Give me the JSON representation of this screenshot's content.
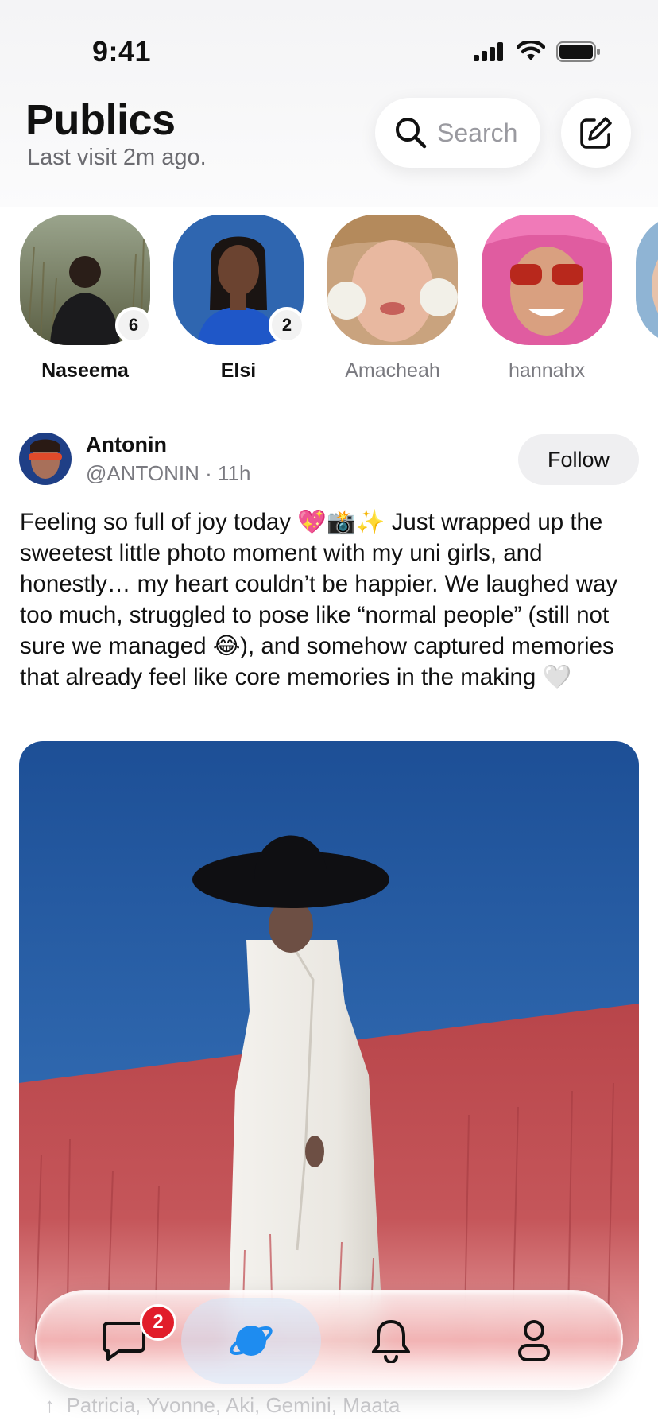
{
  "status_bar": {
    "time": "9:41"
  },
  "header": {
    "title": "Publics",
    "subtitle": "Last visit 2m ago.",
    "search_placeholder": "Search"
  },
  "stories": [
    {
      "name": "Naseema",
      "count": "6",
      "seen": false
    },
    {
      "name": "Elsi",
      "count": "2",
      "seen": false
    },
    {
      "name": "Amacheah",
      "count": "",
      "seen": true
    },
    {
      "name": "hannahx",
      "count": "",
      "seen": true
    }
  ],
  "post": {
    "author": "Antonin",
    "handle_time": "@ANTONIN · 11h",
    "follow_label": "Follow",
    "text": "Feeling so full of joy today 💖📸✨ Just wrapped up the sweetest little photo moment with my uni girls, and honestly… my heart couldn’t be happier. We laughed way too much, struggled to pose like “normal people” (still not sure we managed 😂), and somehow captured memories that already feel like core memories in the making 🤍"
  },
  "next_post": {
    "meta": "Patricia, Yvonne, Aki, Gemini, Maata"
  },
  "tab_bar": {
    "tabs": [
      {
        "icon": "chat-bubble-icon",
        "badge": "2",
        "active": false
      },
      {
        "icon": "planet-icon",
        "badge": "",
        "active": true
      },
      {
        "icon": "bell-icon",
        "badge": "",
        "active": false
      },
      {
        "icon": "person-icon",
        "badge": "",
        "active": false
      }
    ]
  },
  "colors": {
    "accent": "#1e8cf0",
    "badge": "#e11d2a",
    "sky": "#2a63a8",
    "field": "#b8454a"
  }
}
